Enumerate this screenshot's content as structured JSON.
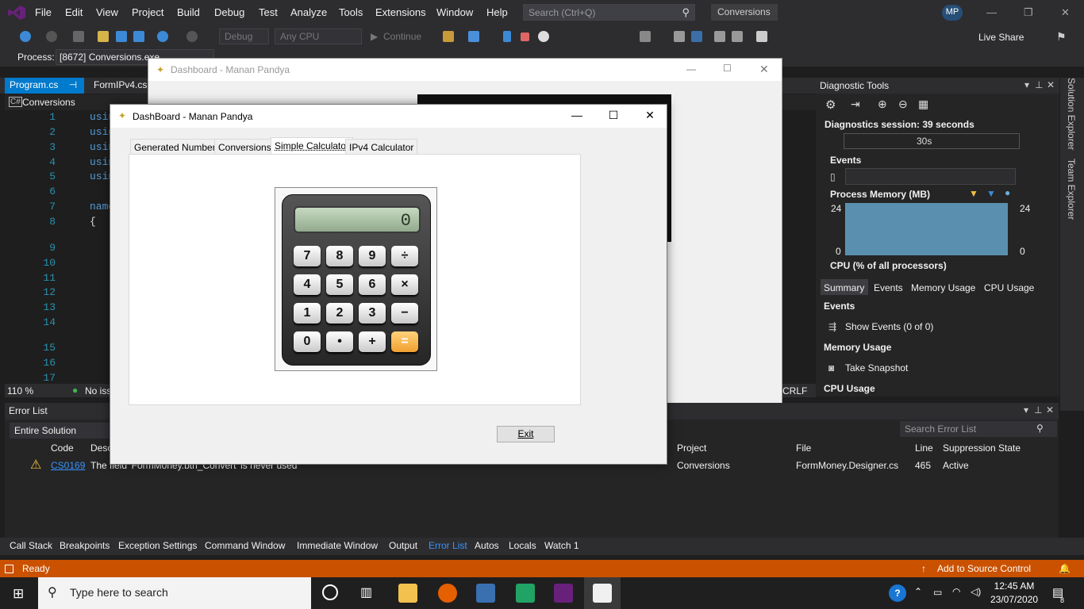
{
  "menubar": {
    "items": [
      "File",
      "Edit",
      "View",
      "Project",
      "Build",
      "Debug",
      "Test",
      "Analyze",
      "Tools",
      "Extensions",
      "Window",
      "Help"
    ],
    "search_placeholder": "Search (Ctrl+Q)",
    "solution_title": "Conversions",
    "avatar_initials": "MP"
  },
  "toolbar": {
    "config": "Debug",
    "platform": "Any CPU",
    "continue_label": "Continue",
    "live_share": "Live Share"
  },
  "process_bar": {
    "label": "Process:",
    "value": "[8672] Conversions.exe"
  },
  "editor": {
    "tabs": [
      "Program.cs",
      "FormIPv4.cs"
    ],
    "nav_scope": "Conversions",
    "zoom": "110 %",
    "issues": "No iss",
    "line_ending": "CRLF",
    "line_numbers": [
      "1",
      "2",
      "3",
      "4",
      "5",
      "6",
      "7",
      "8",
      "9",
      "10",
      "11",
      "12",
      "13",
      "14",
      "15",
      "16",
      "17"
    ],
    "code_fragments": [
      "usin",
      "usin",
      "usin",
      "usin",
      "usin",
      "name",
      "{"
    ]
  },
  "diagnostics": {
    "title": "Diagnostic Tools",
    "session": "Diagnostics session: 39 seconds",
    "timeline_tick": "30s",
    "events_label": "Events",
    "process_memory_label": "Process Memory (MB)",
    "mem_max_left": "24",
    "mem_min_left": "0",
    "mem_max_right": "24",
    "mem_min_right": "0",
    "cpu_label": "CPU (% of all processors)",
    "tabs": [
      "Summary",
      "Events",
      "Memory Usage",
      "CPU Usage"
    ],
    "events_section": "Events",
    "show_events": "Show Events (0 of 0)",
    "memory_section": "Memory Usage",
    "take_snapshot": "Take Snapshot",
    "cpu_section": "CPU Usage"
  },
  "side_rail": {
    "solution_explorer": "Solution Explorer",
    "team_explorer": "Team Explorer"
  },
  "error_list": {
    "title": "Error List",
    "filter": "Entire Solution",
    "search_placeholder": "Search Error List",
    "columns": {
      "code": "Code",
      "description": "Desc",
      "project": "Project",
      "file": "File",
      "line": "Line",
      "suppression": "Suppression State"
    },
    "row": {
      "code": "CS0169",
      "description": "The field 'FormMoney.btn_Convert' is never used",
      "project": "Conversions",
      "file": "FormMoney.Designer.cs",
      "line": "465",
      "suppression": "Active"
    }
  },
  "bottom_tabs": [
    "Call Stack",
    "Breakpoints",
    "Exception Settings",
    "Command Window",
    "Immediate Window",
    "Output",
    "Error List",
    "Autos",
    "Locals",
    "Watch 1"
  ],
  "status": {
    "ready": "Ready",
    "source_control": "Add to Source Control"
  },
  "back_window": {
    "title": "Dashboard - Manan Pandya"
  },
  "front_window": {
    "title": "DashBoard - Manan Pandya",
    "tabs": [
      "Generated Numbers",
      "Conversions",
      "Simple Calculator",
      "IPv4 Calculator"
    ],
    "active_tab": "Simple Calculator",
    "calculator": {
      "display": "0",
      "keys": [
        "7",
        "8",
        "9",
        "÷",
        "4",
        "5",
        "6",
        "×",
        "1",
        "2",
        "3",
        "−",
        "0",
        "•",
        "+",
        "="
      ]
    },
    "exit_label": "Exit"
  },
  "taskbar": {
    "search_placeholder": "Type here to search",
    "time": "12:45 AM",
    "date": "23/07/2020",
    "notifications": "8"
  },
  "colors": {
    "accent_status": "#ca5100",
    "vs_purple": "#68217a",
    "chart_fill": "#5a8fb0"
  }
}
